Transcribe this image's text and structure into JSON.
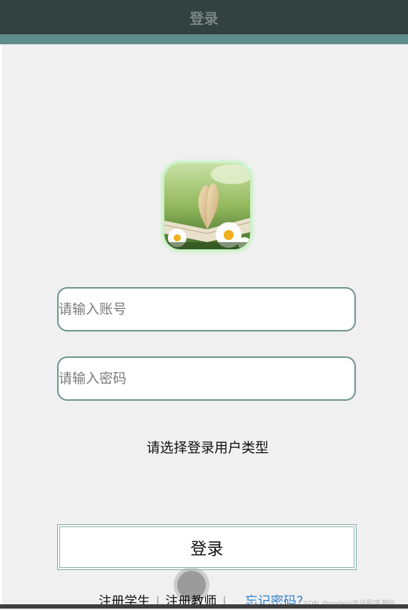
{
  "header": {
    "title": "登录"
  },
  "login_form": {
    "account_placeholder": "请输入账号",
    "password_placeholder": "请输入密码",
    "user_type_prompt": "请选择登录用户类型",
    "login_button": "登录"
  },
  "footer": {
    "register_student": "注册学生",
    "register_teacher": "注册教师",
    "separator": "|",
    "forgot_password": "忘记密码？"
  },
  "watermark": "CSDN @nodejs毕设程序源码",
  "colors": {
    "header_bg": "#334140",
    "accent": "#5f8d89",
    "link": "#2f7fc9"
  }
}
